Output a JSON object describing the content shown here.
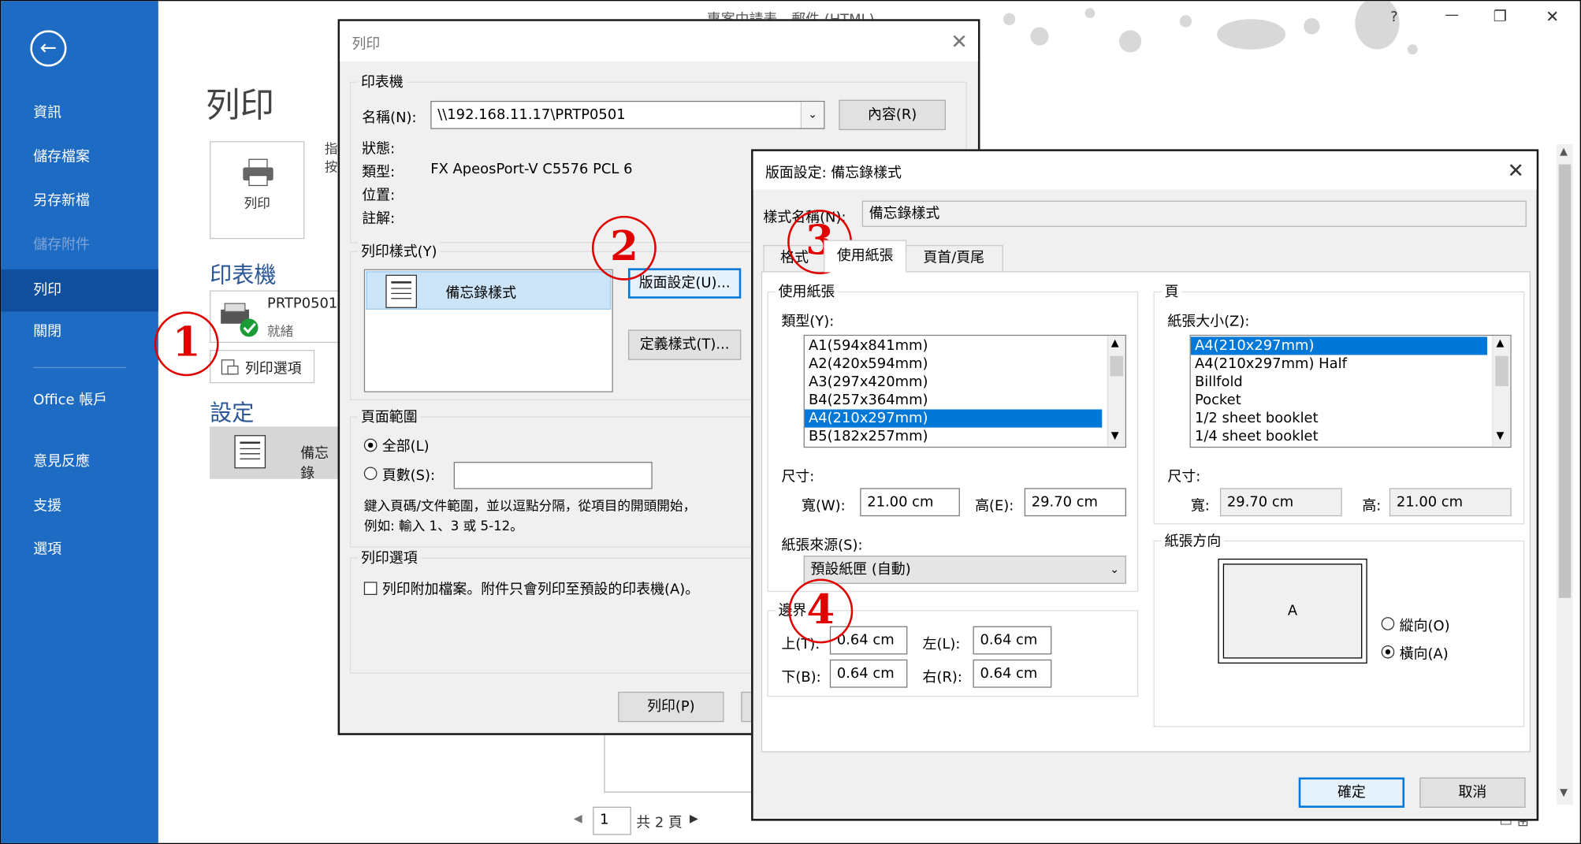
{
  "window": {
    "title": "專案中請表 - 郵件 (HTML)",
    "help": "?",
    "minimize": "—",
    "restore": "❐",
    "close": "✕"
  },
  "sidebar": {
    "back": "←",
    "items": [
      {
        "label": "資訊"
      },
      {
        "label": "儲存檔案"
      },
      {
        "label": "另存新檔"
      },
      {
        "label": "儲存附件"
      },
      {
        "label": "列印"
      },
      {
        "label": "關閉"
      },
      {
        "label": "Office 帳戶"
      },
      {
        "label": "意見反應"
      },
      {
        "label": "支援"
      },
      {
        "label": "選項"
      }
    ]
  },
  "backstage": {
    "heading": "列印",
    "print_button": "列印",
    "print_desc": "指\n按",
    "printer_heading": "印表機",
    "printer_name": "PRTP0501",
    "printer_status": "就緒",
    "print_options_button": "列印選項",
    "settings_heading": "設定",
    "style_label": "備忘錄",
    "page_number": "1",
    "page_total": "共 2 頁"
  },
  "print_dialog": {
    "title": "列印",
    "printer_group": "印表機",
    "name_label": "名稱(N):",
    "name_value": "\\\\192.168.11.17\\PRTP0501",
    "properties_button": "內容(R)",
    "status_label": "狀態:",
    "type_label": "類型:",
    "type_value": "FX ApeosPort-V C5576 PCL 6",
    "where_label": "位置:",
    "comment_label": "註解:",
    "style_group": "列印樣式(Y)",
    "style_item": "備忘錄樣式",
    "page_setup_button": "版面設定(U)...",
    "define_styles_button": "定義樣式(T)...",
    "range_group": "頁面範圍",
    "all_label": "全部(L)",
    "pages_label": "頁數(S):",
    "range_hint_1": "鍵入頁碼/文件範圍，並以逗點分隔，從項目的開頭開始，",
    "range_hint_2": "例如: 輸入 1、3 或 5-12。",
    "options_group": "列印選項",
    "attach_label": "列印附加檔案。附件只會列印至預設的印表機(A)。",
    "print_button": "列印(P)"
  },
  "page_setup": {
    "title": "版面設定: 備忘錄樣式",
    "style_name_label": "樣式名稱(N):",
    "style_name_value": "備忘錄樣式",
    "tabs": [
      {
        "label": "格式"
      },
      {
        "label": "使用紙張"
      },
      {
        "label": "頁首/頁尾"
      }
    ],
    "paper_group": "使用紙張",
    "type_label": "類型(Y):",
    "paper_types": [
      "A1(594x841mm)",
      "A2(420x594mm)",
      "A3(297x420mm)",
      "B4(257x364mm)",
      "A4(210x297mm)",
      "B5(182x257mm)"
    ],
    "paper_selected": "A4(210x297mm)",
    "dimensions_label": "尺寸:",
    "width_label": "寬(W):",
    "width_value": "21.00 cm",
    "height_label": "高(E):",
    "height_value": "29.70 cm",
    "source_label": "紙張來源(S):",
    "source_value": "預設紙匣 (自動)",
    "margins_group": "邊界",
    "top_label": "上(T):",
    "top_value": "0.64 cm",
    "left_label": "左(L):",
    "left_value": "0.64 cm",
    "bottom_label": "下(B):",
    "bottom_value": "0.64 cm",
    "right_label": "右(R):",
    "right_value": "0.64 cm",
    "page_group": "頁",
    "size_label": "紙張大小(Z):",
    "page_sizes": [
      "A4(210x297mm)",
      "A4(210x297mm) Half",
      "Billfold",
      "Pocket",
      "1/2 sheet booklet",
      "1/4 sheet booklet"
    ],
    "page_selected": "A4(210x297mm)",
    "page_dimensions_label": "尺寸:",
    "page_width_label": "寬:",
    "page_width_value": "29.70 cm",
    "page_height_label": "高:",
    "page_height_value": "21.00 cm",
    "orientation_group": "紙張方向",
    "preview_letter": "A",
    "portrait_label": "縱向(O)",
    "landscape_label": "橫向(A)",
    "ok_button": "確定",
    "cancel_button": "取消"
  },
  "annotations": [
    "1",
    "2",
    "3",
    "4"
  ],
  "colors": {
    "sidebar": "#1e6bc4",
    "selection": "#0078d7",
    "annotation": "#e00000"
  }
}
